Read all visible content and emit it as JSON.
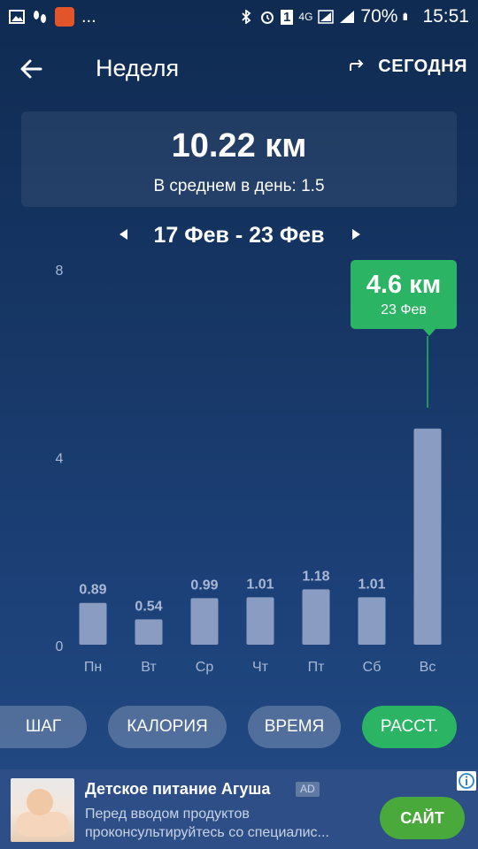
{
  "status_bar": {
    "time": "15:51",
    "battery_percent": "70%",
    "network": "4G",
    "sim_badge": "1",
    "more": "..."
  },
  "header": {
    "title": "Неделя",
    "today_label": "СЕГОДНЯ"
  },
  "summary": {
    "total": "10.22 км",
    "average_label": "В среднем в день:",
    "average_value": "1.5"
  },
  "range": {
    "label": "17 Фев - 23 Фев"
  },
  "chart_data": {
    "type": "bar",
    "categories": [
      "Пн",
      "Вт",
      "Ср",
      "Чт",
      "Пт",
      "Сб",
      "Вс"
    ],
    "values": [
      0.89,
      0.54,
      0.99,
      1.01,
      1.18,
      1.01,
      4.6
    ],
    "value_labels": [
      "0.89",
      "0.54",
      "0.99",
      "1.01",
      "1.18",
      "1.01",
      ""
    ],
    "y_ticks": [
      "0",
      "4",
      "8"
    ],
    "ylim": [
      0,
      8
    ],
    "bar_color": "#8a9cc1",
    "label_color": "#a9b8d4",
    "selected_index": 6,
    "tooltip": {
      "value": "4.6 км",
      "date": "23 Фев",
      "color": "#2ab463"
    }
  },
  "tabs": [
    {
      "label": "ШАГ",
      "active": false
    },
    {
      "label": "КАЛОРИЯ",
      "active": false
    },
    {
      "label": "ВРЕМЯ",
      "active": false
    },
    {
      "label": "РАССТ.",
      "active": true
    }
  ],
  "ad": {
    "title": "Детское питание Агуша",
    "badge": "AD",
    "description": "Перед вводом продуктов проконсультируйтесь со специалис...",
    "cta": "САЙТ"
  },
  "colors": {
    "accent": "#2ab463",
    "ad_button": "#49a93a"
  }
}
